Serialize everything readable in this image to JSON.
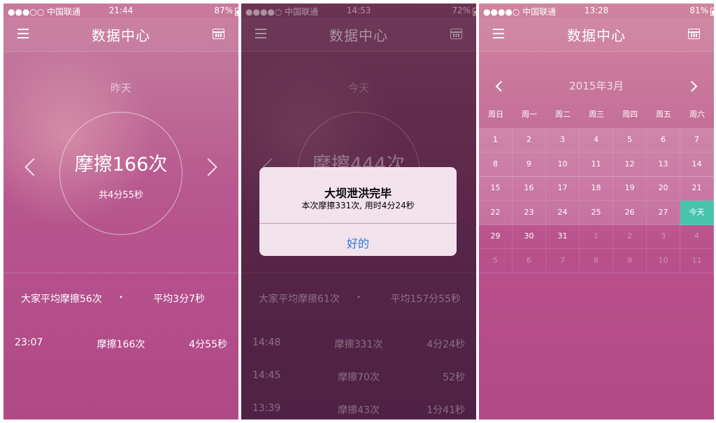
{
  "phones": [
    {
      "status": {
        "carrier": "●●●○○ 中国联通",
        "time": "21:44",
        "battery": "87%"
      },
      "title": "数据中心",
      "day_label": "昨天",
      "main_count": "摩擦166次",
      "main_duration": "共4分55秒",
      "avg_count": "大家平均摩擦56次",
      "avg_dot": "•",
      "avg_time": "平均3分7秒",
      "records": [
        {
          "time": "23:07",
          "count": "摩擦166次",
          "duration": "4分55秒"
        }
      ]
    },
    {
      "status": {
        "carrier": "●●●●○ 中国联通",
        "time": "14:53",
        "battery": "72%"
      },
      "title": "数据中心",
      "day_label": "今天",
      "main_count": "摩擦444次",
      "avg_count": "大家平均摩擦61次",
      "avg_dot": "•",
      "avg_time": "平均157分55秒",
      "records": [
        {
          "time": "14:48",
          "count": "摩擦331次",
          "duration": "4分24秒"
        },
        {
          "time": "14:45",
          "count": "摩擦70次",
          "duration": "52秒"
        },
        {
          "time": "13:39",
          "count": "摩擦43次",
          "duration": "1分41秒"
        }
      ],
      "alert": {
        "title": "大坝泄洪完毕",
        "message": "本次摩擦331次, 用时4分24秒",
        "button": "好的"
      }
    },
    {
      "status": {
        "carrier": "●●●●○ 中国联通",
        "time": "13:28",
        "battery": "81%"
      },
      "title": "数据中心",
      "month": "2015年3月",
      "weekdays": [
        "周日",
        "周一",
        "周二",
        "周三",
        "周四",
        "周五",
        "周六"
      ],
      "days": [
        "1",
        "2",
        "3",
        "4",
        "5",
        "6",
        "7",
        "8",
        "9",
        "10",
        "11",
        "12",
        "13",
        "14",
        "15",
        "16",
        "17",
        "18",
        "19",
        "20",
        "21",
        "22",
        "23",
        "24",
        "25",
        "26",
        "27",
        "今天",
        "29",
        "30",
        "31",
        "1",
        "2",
        "3",
        "4",
        "5",
        "6",
        "7",
        "8",
        "9",
        "10",
        "11"
      ],
      "current_month_count": 31,
      "today_label": "今天"
    }
  ],
  "colors": {
    "today": "#48c3ad",
    "alert_button": "#2a7bde"
  }
}
